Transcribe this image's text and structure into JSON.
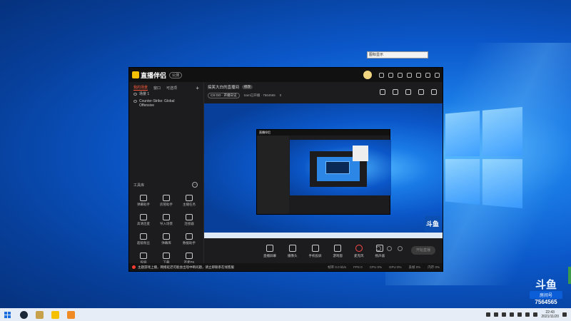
{
  "tooltip": "图标显示",
  "app": {
    "name": "直播伴侣",
    "badge": "公测",
    "tabs": [
      "我的场景",
      "窗口",
      "可选项"
    ],
    "scenes": [
      {
        "label": "场景 1"
      },
      {
        "label": "Counter-Strike: Global Offensive"
      }
    ],
    "tools_title": "工具库",
    "tools": [
      "弹幕助手",
      "房管助手",
      "主播任务",
      "高清连麦",
      "导入场景",
      "连接器",
      "超级粉丝",
      "弹幕库",
      "数据助手",
      "投屏",
      "下载",
      "连麦PK"
    ],
    "room_title": "搞笑大白的直播间",
    "edit_label": "修改",
    "category": "CS:GO · 开播日记",
    "room_info": "Sam已开播 · 7564565",
    "heat": "0",
    "controls": [
      "直播屏幕",
      "摄像头",
      "手机投屏",
      "游戏窗",
      "麦克风",
      "扬声器"
    ],
    "go_live": "开始直播",
    "warning": "主题游戏上播，网络延迟可能会出现中断问题，请立即联系在线客服",
    "stats": [
      "帧率 0.0 kb/s",
      "FPS 0",
      "CPU 0%",
      "GPU 0%",
      "丢帧 0%",
      "内存 0%"
    ],
    "preview_logo": "斗鱼"
  },
  "douyu": {
    "logo": "斗鱼",
    "room_label": "房间号",
    "room_number": "7564565"
  },
  "taskbar": {
    "time": "22:43",
    "date": "2021/11/20"
  },
  "colors": {
    "accent": "#ff5a3a",
    "desktop": "#0b57c9",
    "app_bg": "#1c1c1e"
  }
}
